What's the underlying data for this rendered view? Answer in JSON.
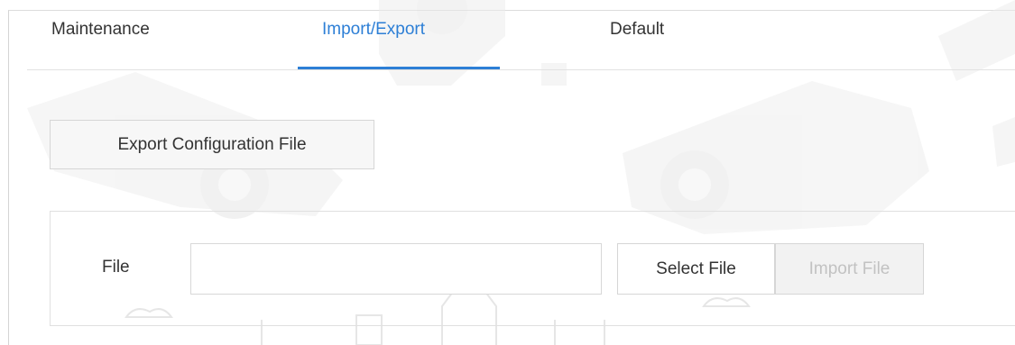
{
  "tabs": [
    {
      "label": "Maintenance",
      "active": false
    },
    {
      "label": "Import/Export",
      "active": true
    },
    {
      "label": "Default",
      "active": false
    }
  ],
  "export": {
    "button_label": "Export Configuration File"
  },
  "import": {
    "file_label": "File",
    "file_value": "",
    "select_button_label": "Select File",
    "import_button_label": "Import File",
    "import_button_enabled": false
  },
  "colors": {
    "accent": "#2d7fd6",
    "disabled_text": "#c2c2c2",
    "border": "#d6d6d6"
  }
}
